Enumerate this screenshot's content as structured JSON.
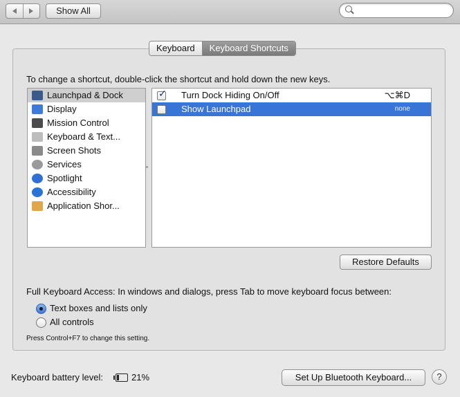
{
  "toolbar": {
    "show_all_label": "Show All",
    "search_placeholder": ""
  },
  "tabs": [
    {
      "label": "Keyboard",
      "active": false
    },
    {
      "label": "Keyboard Shortcuts",
      "active": true
    }
  ],
  "instructions": "To change a shortcut, double-click the shortcut and hold down the new keys.",
  "categories": [
    {
      "label": "Launchpad & Dock",
      "icon": "launchpad-dock-icon",
      "color": "#3a5a8c",
      "selected": true
    },
    {
      "label": "Display",
      "icon": "display-icon",
      "color": "#3d7bd9"
    },
    {
      "label": "Mission Control",
      "icon": "mission-control-icon",
      "color": "#4b4b4b"
    },
    {
      "label": "Keyboard & Text...",
      "icon": "keyboard-icon",
      "color": "#bdbdbd"
    },
    {
      "label": "Screen Shots",
      "icon": "screenshot-icon",
      "color": "#8a8a8a"
    },
    {
      "label": "Services",
      "icon": "gear-icon",
      "color": "#9a9a9a"
    },
    {
      "label": "Spotlight",
      "icon": "spotlight-icon",
      "color": "#2f6fd6"
    },
    {
      "label": "Accessibility",
      "icon": "accessibility-icon",
      "color": "#2a73d8"
    },
    {
      "label": "Application Shor...",
      "icon": "app-shortcuts-icon",
      "color": "#e0a64a"
    }
  ],
  "shortcuts": [
    {
      "name": "Turn Dock Hiding On/Off",
      "key": "⌥⌘D",
      "checked": true,
      "selected": false
    },
    {
      "name": "Show Launchpad",
      "key": "none",
      "checked": false,
      "selected": true
    }
  ],
  "restore_defaults_label": "Restore Defaults",
  "full_keyboard_access": {
    "text": "Full Keyboard Access: In windows and dialogs, press Tab to move keyboard focus between:",
    "options": [
      {
        "label": "Text boxes and lists only",
        "selected": true
      },
      {
        "label": "All controls",
        "selected": false
      }
    ],
    "note": "Press Control+F7 to change this setting."
  },
  "footer": {
    "battery_label": "Keyboard battery level:",
    "battery_value": "21%",
    "bluetooth_button_label": "Set Up Bluetooth Keyboard...",
    "help_label": "?"
  },
  "colors": {
    "selection_blue": "#3875d7",
    "selected_gray": "#cfcfcf"
  }
}
